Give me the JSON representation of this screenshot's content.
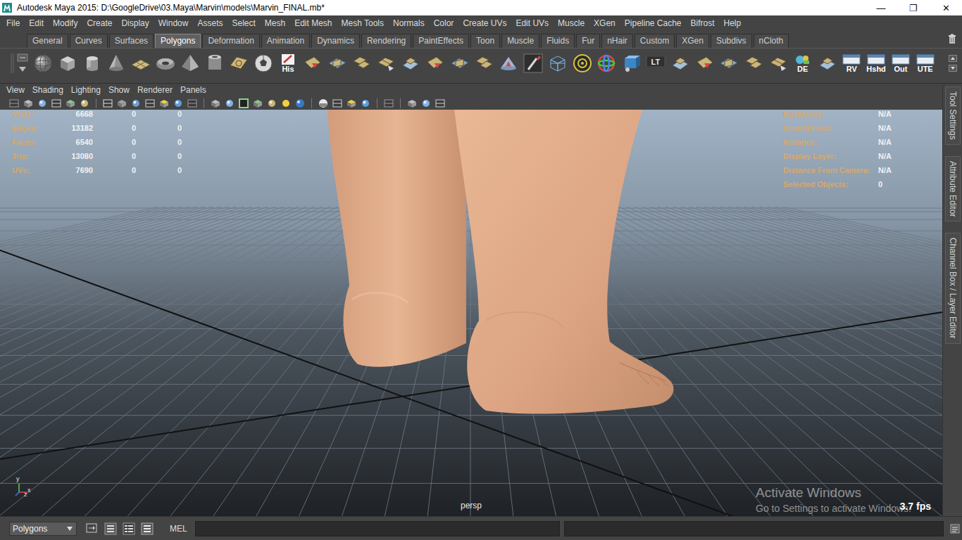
{
  "window": {
    "title": "Autodesk Maya 2015: D:\\GoogleDrive\\03.Maya\\Marvin\\models\\Marvin_FINAL.mb*",
    "controls": [
      "—",
      "❐",
      "✕"
    ]
  },
  "menubar": [
    "File",
    "Edit",
    "Modify",
    "Create",
    "Display",
    "Window",
    "Assets",
    "Select",
    "Mesh",
    "Edit Mesh",
    "Mesh Tools",
    "Normals",
    "Color",
    "Create UVs",
    "Edit UVs",
    "Muscle",
    "XGen",
    "Pipeline Cache",
    "Bifrost",
    "Help"
  ],
  "shelf": {
    "tabs": [
      {
        "label": "General",
        "selected": false
      },
      {
        "label": "Curves",
        "selected": false
      },
      {
        "label": "Surfaces",
        "selected": false
      },
      {
        "label": "Polygons",
        "selected": true
      },
      {
        "label": "Deformation",
        "selected": false
      },
      {
        "label": "Animation",
        "selected": false
      },
      {
        "label": "Dynamics",
        "selected": false
      },
      {
        "label": "Rendering",
        "selected": false
      },
      {
        "label": "PaintEffects",
        "selected": false
      },
      {
        "label": "Toon",
        "selected": false
      },
      {
        "label": "Muscle",
        "selected": false
      },
      {
        "label": "Fluids",
        "selected": false
      },
      {
        "label": "Fur",
        "selected": false
      },
      {
        "label": "nHair",
        "selected": false
      },
      {
        "label": "Custom",
        "selected": false
      },
      {
        "label": "XGen",
        "selected": false
      },
      {
        "label": "Subdivs",
        "selected": false
      },
      {
        "label": "nCloth",
        "selected": false
      }
    ],
    "items": [
      {
        "kind": "icon"
      },
      {
        "kind": "icon"
      },
      {
        "kind": "icon"
      },
      {
        "kind": "icon"
      },
      {
        "kind": "icon"
      },
      {
        "kind": "icon"
      },
      {
        "kind": "icon"
      },
      {
        "kind": "icon"
      },
      {
        "kind": "icon"
      },
      {
        "kind": "icon"
      },
      {
        "kind": "label",
        "label": "His"
      },
      {
        "kind": "icon"
      },
      {
        "kind": "icon"
      },
      {
        "kind": "icon"
      },
      {
        "kind": "icon"
      },
      {
        "kind": "icon"
      },
      {
        "kind": "icon"
      },
      {
        "kind": "icon"
      },
      {
        "kind": "icon"
      },
      {
        "kind": "icon"
      },
      {
        "kind": "icon"
      },
      {
        "kind": "icon"
      },
      {
        "kind": "icon"
      },
      {
        "kind": "icon"
      },
      {
        "kind": "icon"
      },
      {
        "kind": "label",
        "label": "LT"
      },
      {
        "kind": "icon"
      },
      {
        "kind": "icon"
      },
      {
        "kind": "icon"
      },
      {
        "kind": "icon"
      },
      {
        "kind": "icon"
      },
      {
        "kind": "label",
        "label": "DE"
      },
      {
        "kind": "icon"
      },
      {
        "kind": "label",
        "label": "RV"
      },
      {
        "kind": "label",
        "label": "Hshd"
      },
      {
        "kind": "label",
        "label": "Out"
      },
      {
        "kind": "label",
        "label": "UTE"
      }
    ]
  },
  "panel_menu": [
    "View",
    "Shading",
    "Lighting",
    "Show",
    "Renderer",
    "Panels"
  ],
  "hud": {
    "poly_count": [
      {
        "label": "Verts:",
        "values": [
          "6668",
          "0",
          "0"
        ]
      },
      {
        "label": "Edges:",
        "values": [
          "13182",
          "0",
          "0"
        ]
      },
      {
        "label": "Faces:",
        "values": [
          "6540",
          "0",
          "0"
        ]
      },
      {
        "label": "Tris:",
        "values": [
          "13080",
          "0",
          "0"
        ]
      },
      {
        "label": "UVs:",
        "values": [
          "7690",
          "0",
          "0"
        ]
      }
    ],
    "details": [
      {
        "label": "Backfaces:",
        "value": "N/A"
      },
      {
        "label": "Smoothness:",
        "value": "N/A"
      },
      {
        "label": "Instance:",
        "value": "N/A"
      },
      {
        "label": "Display Layer:",
        "value": "N/A"
      },
      {
        "label": "Distance From Camera:",
        "value": "N/A"
      },
      {
        "label": "Selected Objects:",
        "value": "0"
      }
    ]
  },
  "viewport": {
    "camera": "persp",
    "fps": "3.7 fps",
    "axis": [
      "y",
      "x",
      "z"
    ]
  },
  "watermark": {
    "title": "Activate Windows",
    "subtitle": "Go to Settings to activate Windows."
  },
  "side_tabs": [
    "Tool Settings",
    "Attribute Editor",
    "Channel Box / Layer Editor"
  ],
  "command_line": {
    "mode": "Polygons",
    "language": "MEL"
  }
}
